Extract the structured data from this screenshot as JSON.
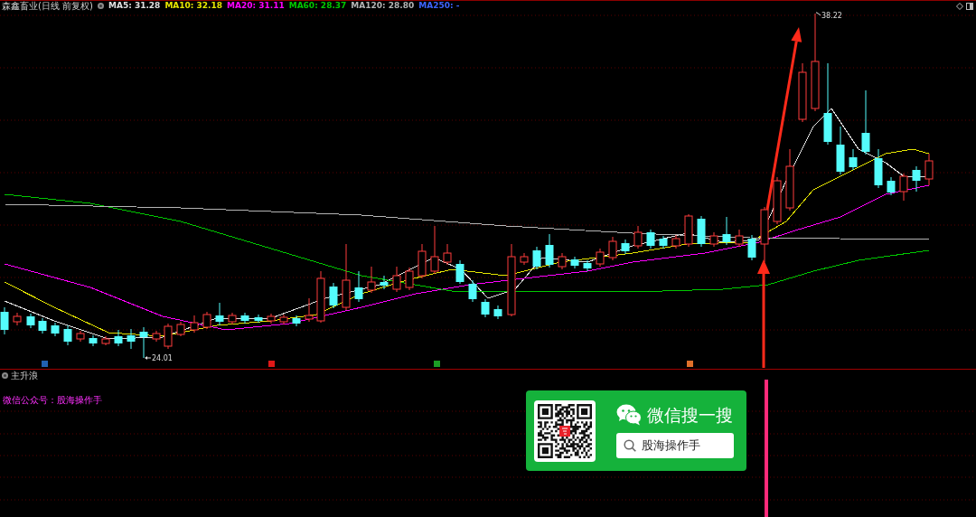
{
  "header": {
    "title": "森鑫畜业(日线 前复权)",
    "averages": [
      {
        "label": "MA5: 31.28",
        "color": "#e0e0e0"
      },
      {
        "label": "MA10: 32.18",
        "color": "#e6e600"
      },
      {
        "label": "MA20: 31.11",
        "color": "#ff00ff"
      },
      {
        "label": "MA60: 28.37",
        "color": "#00c800"
      },
      {
        "label": "MA120: 28.80",
        "color": "#b4b4b4"
      },
      {
        "label": "MA250: -",
        "color": "#3c64ff"
      }
    ]
  },
  "price_chart": {
    "high_label": "38.22",
    "low_label": "24.01",
    "markers": [
      {
        "color": "#2060b0"
      },
      {
        "color": "#e01818"
      },
      {
        "color": "#1c9c24"
      },
      {
        "color": "#e0702a"
      }
    ]
  },
  "indicator_panel": {
    "title": "主升浪",
    "note": "微信公众号：股海操作手"
  },
  "wechat_card": {
    "heading": "微信搜一搜",
    "search_field": {
      "value": "股海操作手"
    }
  }
}
